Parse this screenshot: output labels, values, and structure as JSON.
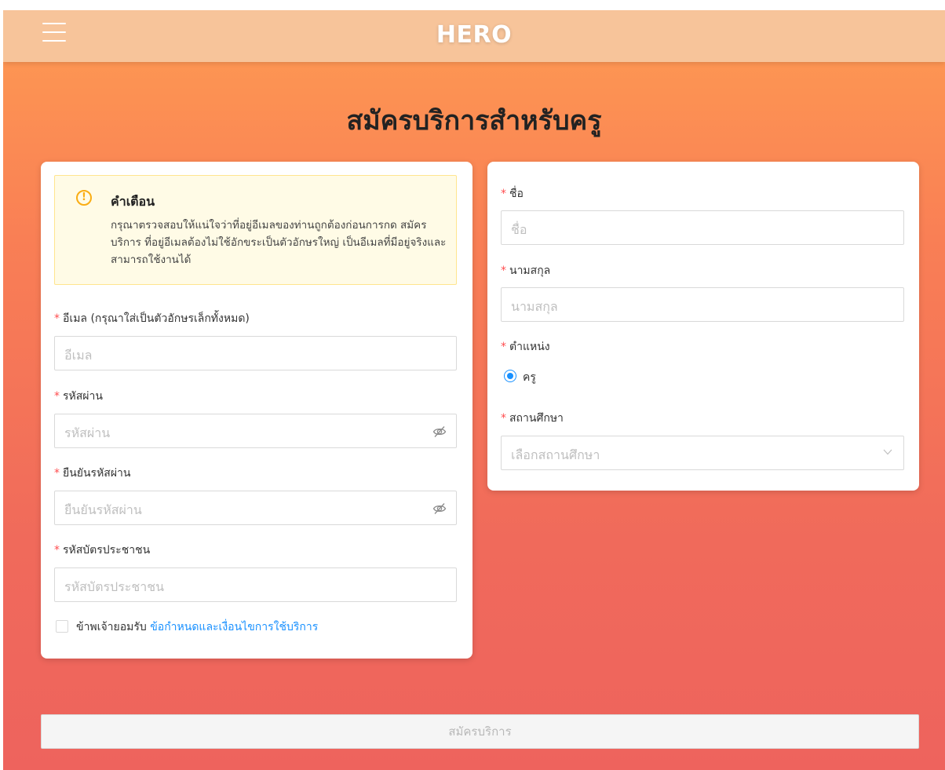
{
  "header": {
    "logo": "HERO"
  },
  "page_title": "สมัครบริการสำหรับครู",
  "alert": {
    "title": "คำเตือน",
    "text": "กรุณาตรวจสอบให้แน่ใจว่าที่อยู่อีเมลของท่านถูกต้องก่อนการกด สมัครบริการ ที่อยู่อีเมลต้องไม่ใช้อักขระเป็นตัวอักษรใหญ่ เป็นอีเมลที่มีอยู่จริงและสามารถใช้งานได้"
  },
  "required_mark": "*",
  "form_left": {
    "email_label": "อีเมล (กรุณาใส่เป็นตัวอักษรเล็กทั้งหมด)",
    "email_placeholder": "อีเมล",
    "password_label": "รหัสผ่าน",
    "password_placeholder": "รหัสผ่าน",
    "confirm_label": "ยืนยันรหัสผ่าน",
    "confirm_placeholder": "ยืนยันรหัสผ่าน",
    "id_label": "รหัสบัตรประชาชน",
    "id_placeholder": "รหัสบัตรประชาชน",
    "agree_text": "ข้าพเจ้ายอมรับ",
    "terms_link": "ข้อกำหนดและเงื่อนไขการใช้บริการ"
  },
  "form_right": {
    "firstname_label": "ชื่อ",
    "firstname_placeholder": "ชื่อ",
    "lastname_label": "นามสกุล",
    "lastname_placeholder": "นามสกุล",
    "position_label": "ตำแหน่ง",
    "position_option": "ครู",
    "school_label": "สถานศึกษา",
    "school_placeholder": "เลือกสถานศึกษา"
  },
  "submit_label": "สมัครบริการ",
  "colors": {
    "accent": "#1890ff",
    "required": "#ff4d4f",
    "warning": "#faad14",
    "header_bg": "#f7c49a",
    "gradient_top": "#fe9b52",
    "gradient_bottom": "#ee635d"
  }
}
